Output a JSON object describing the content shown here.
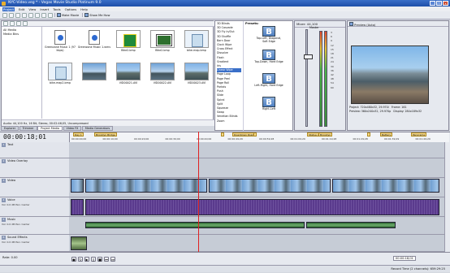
{
  "window": {
    "title": "NYC-Video.veg * - Vegas Movie Studio Platinum 9.0"
  },
  "menu": [
    "Project",
    "Edit",
    "View",
    "Insert",
    "Tools",
    "Options",
    "Help"
  ],
  "toolbar": {
    "make_movie": "Make Movie",
    "show_me_how": "Show Me How"
  },
  "explorer": {
    "tree": [
      "All Media",
      "Media Bins"
    ],
    "items": [
      {
        "label": "Greenzone Music 1 (97 kbps)",
        "kind": "doc"
      },
      {
        "label": "Greenzone Music 1.wmv",
        "kind": "doc"
      },
      {
        "label": "Bike2.bmp",
        "kind": "sign"
      },
      {
        "label": "Bike2.bmp",
        "kind": "road"
      },
      {
        "label": "bike-map.bmp",
        "kind": "map"
      },
      {
        "label": "bike-map2.bmp",
        "kind": "map"
      },
      {
        "label": "",
        "kind": "bridge"
      },
      {
        "label": "VID00021.AVI",
        "kind": "sky"
      },
      {
        "label": "VID00022.AVI",
        "kind": "bridge"
      },
      {
        "label": "VID00023.AVI",
        "kind": "sky"
      }
    ],
    "status": "Audio: 44,100 Hz, 16 Bit, Stereo, 00:02:46;05, Uncompressed"
  },
  "bottom_tabs": [
    "Explorer",
    "Trimmer",
    "Project Media",
    "Video FX",
    "Media Generators"
  ],
  "transitions": {
    "list": [
      "3D Blinds",
      "3D Cascade",
      "3D Fly In/Out",
      "3D Shuffle",
      "Barn Door",
      "Clock Wipe",
      "Cross Effect",
      "Dissolve",
      "Flash",
      "Gradient",
      "Iris",
      "Linear Wipe",
      "Page Loop",
      "Page Peel",
      "Page Roll",
      "Portals",
      "Push",
      "Slide",
      "Spiral",
      "Split",
      "Squeeze",
      "Swap",
      "Venetian Blinds",
      "Zoom"
    ],
    "selected": "Linear Wipe",
    "presets_title": "Presets:",
    "presets": [
      "Top-Left, Diagonal, Soft Edge",
      "Top-Down, Hard Edge",
      "Left-Right, Hard Edge",
      "Right-Left"
    ]
  },
  "mixer": {
    "title": "Mixer: 44,100",
    "master": "Master",
    "scale": [
      "3",
      "6",
      "9",
      "12",
      "15",
      "18",
      "21",
      "24",
      "30",
      "36",
      "42",
      "48",
      "54",
      "60"
    ]
  },
  "preview": {
    "title": "Preview (Auto)",
    "project": "Project: 720x480x32, 29.970i",
    "preview_res": "Preview: 360x240x32, 29.970p",
    "frame_label": "Frame: 161",
    "display": "Display: 284x189x32"
  },
  "timeline": {
    "timecode": "00:00:18;01",
    "markers": [
      "Day 1",
      "Brooklyn Bridge",
      "",
      "Downtown Road",
      "",
      "Statue of Liberty",
      "Brooklyn",
      "",
      "Battery",
      "Panorama"
    ],
    "ticks": [
      "00:00:00;00",
      "00:00:10;00",
      "00:00:20;00",
      "00:00:30;00",
      "00:00:40;00",
      "00:00:49;29",
      "00:00:59;28",
      "00:01:09;29",
      "00:01:19;28",
      "00:01:29;28",
      "00:01:39;29",
      "00:01:49;29"
    ],
    "tracks": [
      {
        "num": "1",
        "name": "Text",
        "sub": ""
      },
      {
        "num": "2",
        "name": "Video Overlay",
        "sub": ""
      },
      {
        "num": "3",
        "name": "Video",
        "sub": ""
      },
      {
        "num": "4",
        "name": "Voice",
        "sub": "Vol: 0.0 dB  Pan: Center"
      },
      {
        "num": "5",
        "name": "Music",
        "sub": "Vol: 0.0 dB  Pan: Center"
      },
      {
        "num": "6",
        "name": "Sound Effects",
        "sub": "Vol: 0.0 dB  Pan: Center"
      }
    ],
    "rate": "Rate: 0.00",
    "end_time": "00:00:18;01"
  },
  "status": {
    "left": "Record Time (2 channels): 659:29:25"
  },
  "colors": {
    "accent": "#3a6fc8",
    "playhead": "#e02020",
    "marker": "#f4d88a"
  }
}
